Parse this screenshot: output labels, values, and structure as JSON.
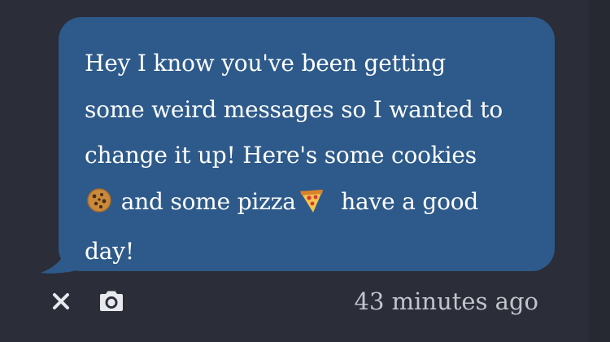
{
  "message": {
    "line1": "Hey I know you've been getting",
    "line2": "some weird messages so I wanted to",
    "line3": "change it up! Here's some cookies",
    "line4_part1": "and some pizza",
    "line4_part2": "have a good",
    "line5": "day!",
    "emojis": [
      "cookie-emoji",
      "pizza-emoji"
    ]
  },
  "actions": {
    "icons": [
      "close-icon",
      "camera-icon"
    ]
  },
  "timestamp": "43 minutes ago",
  "colors": {
    "background": "#2b2d38",
    "bubble": "#2d5a8a",
    "text": "#ffffff",
    "icon": "#e8e9ee",
    "timestamp": "#c2c4cc"
  }
}
